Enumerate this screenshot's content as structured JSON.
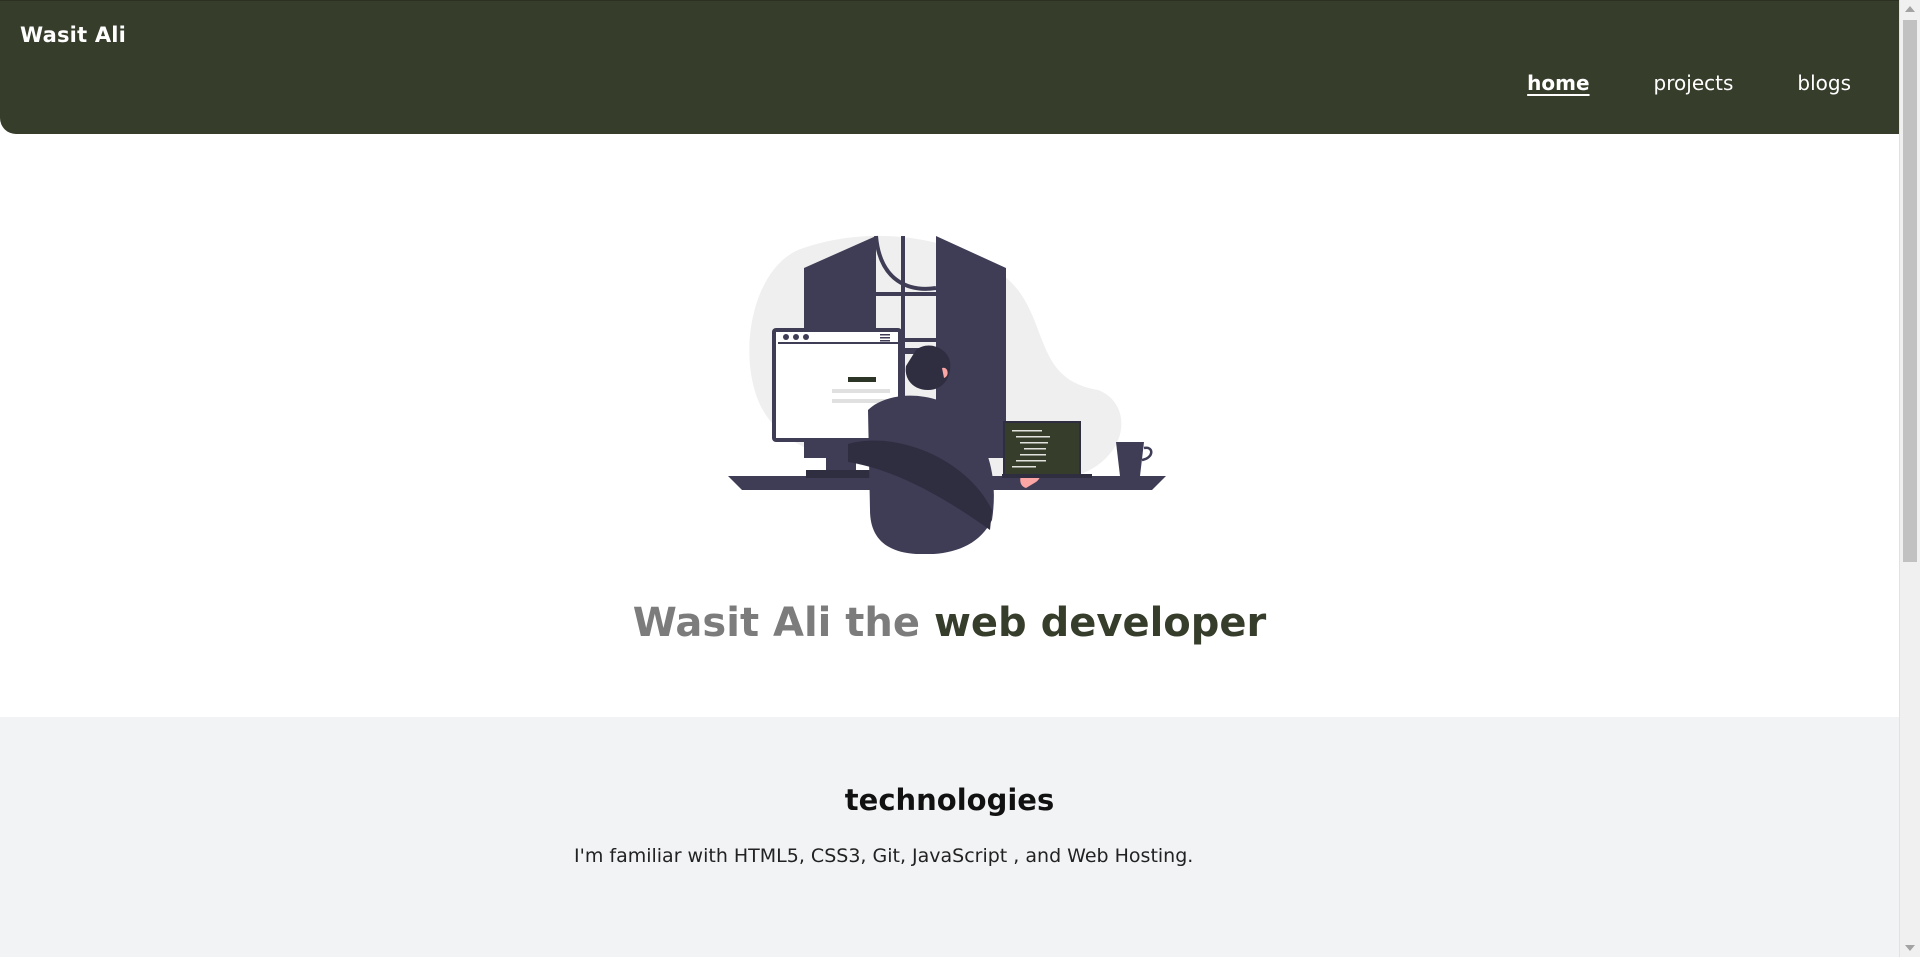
{
  "header": {
    "brand": "Wasit Ali",
    "nav": [
      {
        "label": "home",
        "active": true
      },
      {
        "label": "projects",
        "active": false
      },
      {
        "label": "blogs",
        "active": false
      }
    ]
  },
  "hero": {
    "illustration": "developer-at-desk-illustration",
    "headline_part1": "Wasit Ali the",
    "headline_part2": "web developer"
  },
  "technologies": {
    "title": "technologies",
    "text": "I'm familiar with HTML5, CSS3, Git, JavaScript , and Web Hosting."
  },
  "colors": {
    "header_bg": "#363d2b",
    "accent_dark": "#363d2b",
    "headline_grey": "#7c7c7c",
    "section_bg": "#f2f3f5"
  }
}
